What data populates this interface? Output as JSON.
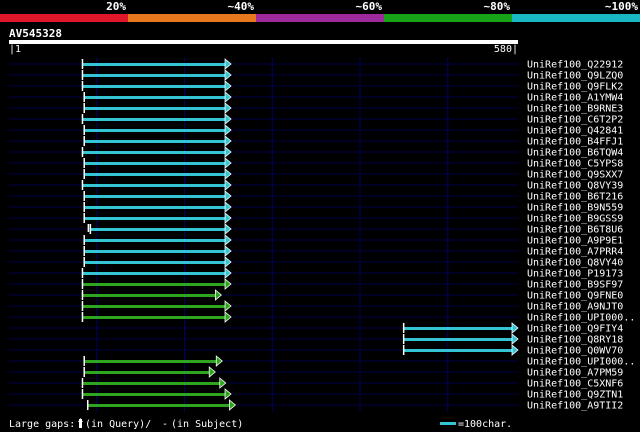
{
  "scale": {
    "colors": [
      "#e0162b",
      "#e8781d",
      "#9c2a9c",
      "#17a317",
      "#17b8c4"
    ],
    "labels": [
      "20%",
      "~40%",
      "~60%",
      "~80%",
      "~100%"
    ]
  },
  "query": {
    "name": "AV545328",
    "start_label": "|1",
    "end_label": "580|",
    "length": 580
  },
  "colors": {
    "cyan": "#33c5d4",
    "green": "#2ea51e",
    "track": "#000044",
    "grid": "#00006a"
  },
  "hits": [
    {
      "name": "UniRef100_Q22912",
      "start": 84,
      "end": 253,
      "color": "cyan"
    },
    {
      "name": "UniRef100_Q9LZQ0",
      "start": 84,
      "end": 253,
      "color": "cyan"
    },
    {
      "name": "UniRef100_Q9FLK2",
      "start": 84,
      "end": 253,
      "color": "cyan"
    },
    {
      "name": "UniRef100_A1YMW4",
      "start": 86,
      "end": 253,
      "color": "cyan"
    },
    {
      "name": "UniRef100_B9RNE3",
      "start": 86,
      "end": 253,
      "color": "cyan"
    },
    {
      "name": "UniRef100_C6T2P2",
      "start": 84,
      "end": 253,
      "color": "cyan"
    },
    {
      "name": "UniRef100_Q42841",
      "start": 86,
      "end": 253,
      "color": "cyan"
    },
    {
      "name": "UniRef100_B4FFJ1",
      "start": 86,
      "end": 253,
      "color": "cyan"
    },
    {
      "name": "UniRef100_B6TQW4",
      "start": 84,
      "end": 253,
      "color": "cyan"
    },
    {
      "name": "UniRef100_C5YPS8",
      "start": 86,
      "end": 253,
      "color": "cyan"
    },
    {
      "name": "UniRef100_Q9SXX7",
      "start": 86,
      "end": 253,
      "color": "cyan"
    },
    {
      "name": "UniRef100_Q8VY39",
      "start": 84,
      "end": 253,
      "color": "cyan"
    },
    {
      "name": "UniRef100_B6T216",
      "start": 86,
      "end": 253,
      "color": "cyan"
    },
    {
      "name": "UniRef100_B9N559",
      "start": 86,
      "end": 253,
      "color": "cyan"
    },
    {
      "name": "UniRef100_B9GSS9",
      "start": 86,
      "end": 253,
      "color": "cyan"
    },
    {
      "name": "UniRef100_B6T8U6",
      "start": 93,
      "end": 253,
      "color": "cyan",
      "gap_marker": true
    },
    {
      "name": "UniRef100_A9P9E1",
      "start": 86,
      "end": 253,
      "color": "cyan"
    },
    {
      "name": "UniRef100_A7PRR4",
      "start": 86,
      "end": 253,
      "color": "cyan"
    },
    {
      "name": "UniRef100_Q8VY40",
      "start": 86,
      "end": 253,
      "color": "cyan"
    },
    {
      "name": "UniRef100_P19173",
      "start": 84,
      "end": 253,
      "color": "cyan"
    },
    {
      "name": "UniRef100_B9SF97",
      "start": 84,
      "end": 253,
      "color": "green"
    },
    {
      "name": "UniRef100_Q9FNE0",
      "start": 84,
      "end": 242,
      "color": "green"
    },
    {
      "name": "UniRef100_A9NJT0",
      "start": 84,
      "end": 253,
      "color": "green"
    },
    {
      "name": "UniRef100_UPI000..",
      "start": 84,
      "end": 253,
      "color": "green"
    },
    {
      "name": "UniRef100_Q9FIY4",
      "start": 450,
      "end": 580,
      "color": "cyan"
    },
    {
      "name": "UniRef100_Q8RY18",
      "start": 450,
      "end": 580,
      "color": "cyan"
    },
    {
      "name": "UniRef100_Q0WV70",
      "start": 450,
      "end": 580,
      "color": "cyan"
    },
    {
      "name": "UniRef100_UPI000..",
      "start": 86,
      "end": 243,
      "color": "green"
    },
    {
      "name": "UniRef100_A7PM59",
      "start": 86,
      "end": 235,
      "color": "green"
    },
    {
      "name": "UniRef100_C5XNF6",
      "start": 84,
      "end": 247,
      "color": "green"
    },
    {
      "name": "UniRef100_Q9ZTN1",
      "start": 84,
      "end": 253,
      "color": "green"
    },
    {
      "name": "UniRef100_A9TII2",
      "start": 90,
      "end": 258,
      "color": "green"
    }
  ],
  "footer": {
    "gaps_label": "Large gaps:",
    "in_query": "(in Query)/",
    "dash": "-",
    "in_subject": "(in Subject)",
    "legend_label": "=100char."
  }
}
